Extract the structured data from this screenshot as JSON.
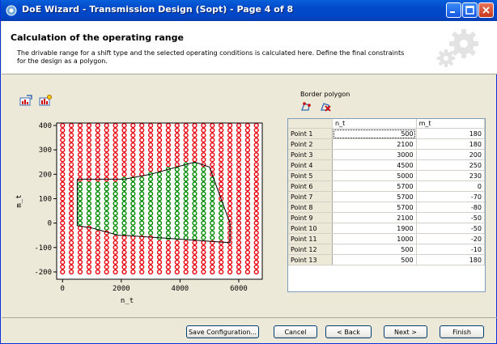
{
  "window": {
    "title": "DoE Wizard - Transmission Design (Sopt) - Page 4 of 8"
  },
  "header": {
    "heading": "Calculation of the operating range",
    "description": "The drivable range for a shift type and the selected operating conditions is calculated here. Define the final constraints for the design as a polygon."
  },
  "plot_toolbar": {
    "icons": [
      "plot-export-icon",
      "plot-settings-icon"
    ]
  },
  "chart_data": {
    "type": "scatter",
    "xlabel": "n_t",
    "ylabel": "m_t",
    "xlim": [
      -200,
      6800
    ],
    "ylim": [
      -230,
      410
    ],
    "xticks": [
      0,
      2000,
      4000,
      6000
    ],
    "yticks": [
      -200,
      -100,
      0,
      100,
      200,
      300,
      400
    ],
    "grid_x": [
      0,
      6600,
      300
    ],
    "grid_y": [
      -200,
      400,
      20
    ],
    "series": [
      {
        "color": "#e8000b",
        "marker": "open-circle",
        "role": "not-drivable"
      },
      {
        "color": "#008a00",
        "marker": "open-circle",
        "role": "drivable"
      }
    ],
    "polygon": {
      "x": [
        500,
        2100,
        3000,
        4500,
        5000,
        5700,
        5700,
        5700,
        2100,
        1900,
        1000,
        500,
        500
      ],
      "y": [
        180,
        180,
        200,
        250,
        230,
        0,
        -70,
        -80,
        -50,
        -50,
        -20,
        -10,
        180
      ]
    }
  },
  "border_polygon": {
    "label": "Border polygon",
    "icons": [
      "add-point-icon",
      "delete-point-icon"
    ],
    "columns": [
      "n_t",
      "m_t"
    ],
    "rows": [
      {
        "name": "Point 1",
        "n_t": "500",
        "m_t": "180"
      },
      {
        "name": "Point 2",
        "n_t": "2100",
        "m_t": "180"
      },
      {
        "name": "Point 3",
        "n_t": "3000",
        "m_t": "200"
      },
      {
        "name": "Point 4",
        "n_t": "4500",
        "m_t": "250"
      },
      {
        "name": "Point 5",
        "n_t": "5000",
        "m_t": "230"
      },
      {
        "name": "Point 6",
        "n_t": "5700",
        "m_t": "0"
      },
      {
        "name": "Point 7",
        "n_t": "5700",
        "m_t": "-70"
      },
      {
        "name": "Point 8",
        "n_t": "5700",
        "m_t": "-80"
      },
      {
        "name": "Point 9",
        "n_t": "2100",
        "m_t": "-50"
      },
      {
        "name": "Point 10",
        "n_t": "1900",
        "m_t": "-50"
      },
      {
        "name": "Point 11",
        "n_t": "1000",
        "m_t": "-20"
      },
      {
        "name": "Point 12",
        "n_t": "500",
        "m_t": "-10"
      },
      {
        "name": "Point 13",
        "n_t": "500",
        "m_t": "180"
      }
    ]
  },
  "buttons": {
    "save": "Save Configuration...",
    "cancel": "Cancel",
    "back": "< Back",
    "next": "Next >",
    "finish": "Finish"
  }
}
